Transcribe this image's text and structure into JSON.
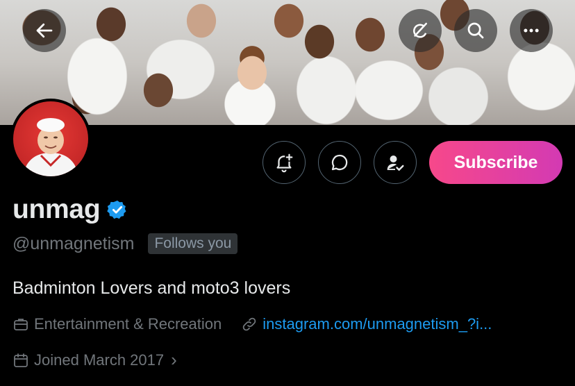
{
  "profile": {
    "name": "unmag",
    "handle": "@unmagnetism",
    "follows_badge": "Follows you",
    "bio": "Badminton Lovers and moto3 lovers",
    "category": "Entertainment & Recreation",
    "link": "instagram.com/unmagnetism_?i...",
    "joined": "Joined March 2017",
    "joined_chevron": "›"
  },
  "actions": {
    "subscribe_label": "Subscribe"
  },
  "colors": {
    "accent": "#1d9bf0",
    "subscribe_start": "#f7488a",
    "subscribe_end": "#d33ab3",
    "verified": "#1d9bf0"
  },
  "icons": {
    "back": "arrow-left-icon",
    "grok": "grok-icon",
    "search": "search-icon",
    "more": "more-icon",
    "notify": "bell-plus-icon",
    "message": "message-bubble-icon",
    "following": "person-check-icon",
    "verified": "verified-badge-icon",
    "category": "briefcase-icon",
    "link": "link-icon",
    "calendar": "calendar-icon"
  }
}
